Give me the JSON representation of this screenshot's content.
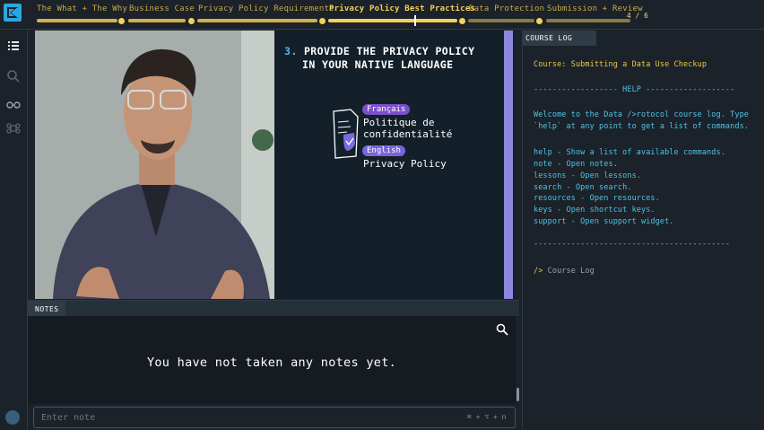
{
  "header": {
    "tabs": [
      {
        "label": "The What + The Why"
      },
      {
        "label": "Business Case"
      },
      {
        "label": "Privacy Policy Requirements"
      },
      {
        "label": "Privacy Policy Best Practices"
      },
      {
        "label": "Data Protection"
      },
      {
        "label": "Submission + Review"
      }
    ],
    "active_tab_index": 3,
    "step_counter": "4 / 6",
    "colors": {
      "accent": "#f3d15b",
      "track": "#d4b04a"
    }
  },
  "rail": {
    "icons": [
      "list-icon",
      "search-icon",
      "glasses-icon",
      "command-icon",
      "help-icon"
    ]
  },
  "slide": {
    "number": "3.",
    "title_line1": "PROVIDE THE PRIVACY POLICY",
    "title_line2": "IN YOUR NATIVE LANGUAGE",
    "badge_fr": "Français",
    "text_fr_line1": "Politique de",
    "text_fr_line2": "confidentialité",
    "badge_en": "English",
    "text_en": "Privacy Policy"
  },
  "notes": {
    "tab_label": "NOTES",
    "empty_message": "You have not taken any notes yet.",
    "input_placeholder": "Enter note",
    "shortcut_hint": "⌘ + ⌥ + n"
  },
  "course_log": {
    "tab_label": "COURSE LOG",
    "course_line": "Course: Submitting a Data Use Checkup",
    "help_divider": "------------------ HELP -------------------",
    "welcome_line1": "Welcome to the Data />rotocol course log. Type",
    "welcome_line2": "`help` at any point to get a list of commands.",
    "commands": [
      "help - Show a list of available commands.",
      "note - Open notes.",
      "lessons - Open lessons.",
      "search - Open search.",
      "resources - Open resources.",
      "keys - Open shortcut keys.",
      "support - Open support widget."
    ],
    "end_divider": "------------------------------------------",
    "prompt_symbol": "/>",
    "prompt_text": "Course Log"
  }
}
